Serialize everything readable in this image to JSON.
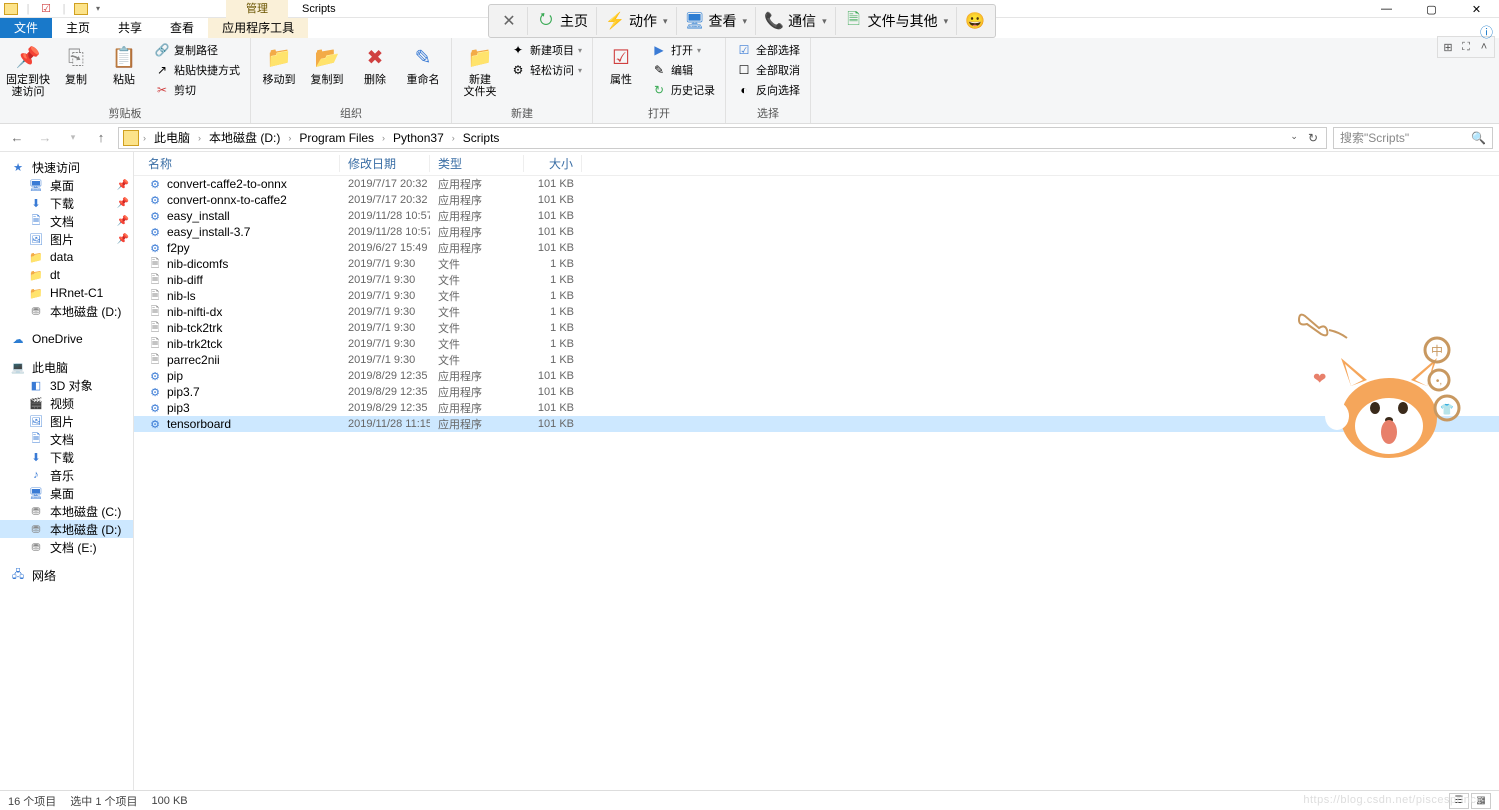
{
  "window": {
    "context_tab": "管理",
    "context_label": "Scripts",
    "min": "—",
    "max": "▢",
    "close": "✕"
  },
  "overlay": {
    "close": "✕",
    "home": "主页",
    "action": "动作",
    "view": "查看",
    "comm": "通信",
    "files": "文件与其他",
    "emoji": "😀"
  },
  "ribbon_tabs": {
    "file": "文件",
    "home": "主页",
    "share": "共享",
    "view": "查看",
    "apptool": "应用程序工具"
  },
  "ribbon": {
    "pin": "固定到快\n速访问",
    "copy": "复制",
    "paste": "粘贴",
    "copy_path": "复制路径",
    "paste_shortcut": "粘贴快捷方式",
    "cut": "剪切",
    "group_clipboard": "剪贴板",
    "move_to": "移动到",
    "copy_to": "复制到",
    "delete": "删除",
    "rename": "重命名",
    "group_organize": "组织",
    "new_folder": "新建\n文件夹",
    "new_item": "新建项目",
    "easy_access": "轻松访问",
    "group_new": "新建",
    "properties": "属性",
    "open_btn": "打开",
    "edit": "编辑",
    "history": "历史记录",
    "group_open": "打开",
    "select_all": "全部选择",
    "select_none": "全部取消",
    "invert_sel": "反向选择",
    "group_select": "选择"
  },
  "breadcrumb": {
    "pc": "此电脑",
    "drive": "本地磁盘 (D:)",
    "pf": "Program Files",
    "py": "Python37",
    "scripts": "Scripts"
  },
  "search": {
    "placeholder": "搜索\"Scripts\""
  },
  "sidebar": {
    "quick": "快速访问",
    "desktop": "桌面",
    "downloads": "下载",
    "docs": "文档",
    "pictures": "图片",
    "data": "data",
    "dt": "dt",
    "hrnet": "HRnet-C1",
    "driveD": "本地磁盘 (D:)",
    "onedrive": "OneDrive",
    "thispc": "此电脑",
    "obj3d": "3D 对象",
    "video": "视频",
    "pictures2": "图片",
    "docs2": "文档",
    "downloads2": "下载",
    "music": "音乐",
    "desktop2": "桌面",
    "driveC": "本地磁盘 (C:)",
    "driveD2": "本地磁盘 (D:)",
    "driveE": "文档 (E:)",
    "network": "网络"
  },
  "columns": {
    "name": "名称",
    "date": "修改日期",
    "type": "类型",
    "size": "大小"
  },
  "types": {
    "app": "应用程序",
    "file": "文件"
  },
  "files": [
    {
      "icon": "exe",
      "name": "convert-caffe2-to-onnx",
      "date": "2019/7/17 20:32",
      "type": "app",
      "size": "101 KB",
      "sel": false
    },
    {
      "icon": "exe",
      "name": "convert-onnx-to-caffe2",
      "date": "2019/7/17 20:32",
      "type": "app",
      "size": "101 KB",
      "sel": false
    },
    {
      "icon": "exe",
      "name": "easy_install",
      "date": "2019/11/28 10:57",
      "type": "app",
      "size": "101 KB",
      "sel": false
    },
    {
      "icon": "exe",
      "name": "easy_install-3.7",
      "date": "2019/11/28 10:57",
      "type": "app",
      "size": "101 KB",
      "sel": false
    },
    {
      "icon": "exe",
      "name": "f2py",
      "date": "2019/6/27 15:49",
      "type": "app",
      "size": "101 KB",
      "sel": false
    },
    {
      "icon": "file",
      "name": "nib-dicomfs",
      "date": "2019/7/1 9:30",
      "type": "file",
      "size": "1 KB",
      "sel": false
    },
    {
      "icon": "file",
      "name": "nib-diff",
      "date": "2019/7/1 9:30",
      "type": "file",
      "size": "1 KB",
      "sel": false
    },
    {
      "icon": "file",
      "name": "nib-ls",
      "date": "2019/7/1 9:30",
      "type": "file",
      "size": "1 KB",
      "sel": false
    },
    {
      "icon": "file",
      "name": "nib-nifti-dx",
      "date": "2019/7/1 9:30",
      "type": "file",
      "size": "1 KB",
      "sel": false
    },
    {
      "icon": "file",
      "name": "nib-tck2trk",
      "date": "2019/7/1 9:30",
      "type": "file",
      "size": "1 KB",
      "sel": false
    },
    {
      "icon": "file",
      "name": "nib-trk2tck",
      "date": "2019/7/1 9:30",
      "type": "file",
      "size": "1 KB",
      "sel": false
    },
    {
      "icon": "file",
      "name": "parrec2nii",
      "date": "2019/7/1 9:30",
      "type": "file",
      "size": "1 KB",
      "sel": false
    },
    {
      "icon": "exe",
      "name": "pip",
      "date": "2019/8/29 12:35",
      "type": "app",
      "size": "101 KB",
      "sel": false
    },
    {
      "icon": "exe",
      "name": "pip3.7",
      "date": "2019/8/29 12:35",
      "type": "app",
      "size": "101 KB",
      "sel": false
    },
    {
      "icon": "exe",
      "name": "pip3",
      "date": "2019/8/29 12:35",
      "type": "app",
      "size": "101 KB",
      "sel": false
    },
    {
      "icon": "exe",
      "name": "tensorboard",
      "date": "2019/11/28 11:15",
      "type": "app",
      "size": "101 KB",
      "sel": true
    }
  ],
  "status": {
    "count": "16 个项目",
    "selected": "选中 1 个项目",
    "size": "100 KB"
  },
  "watermark": "https://blog.csdn.net/piscesprince"
}
